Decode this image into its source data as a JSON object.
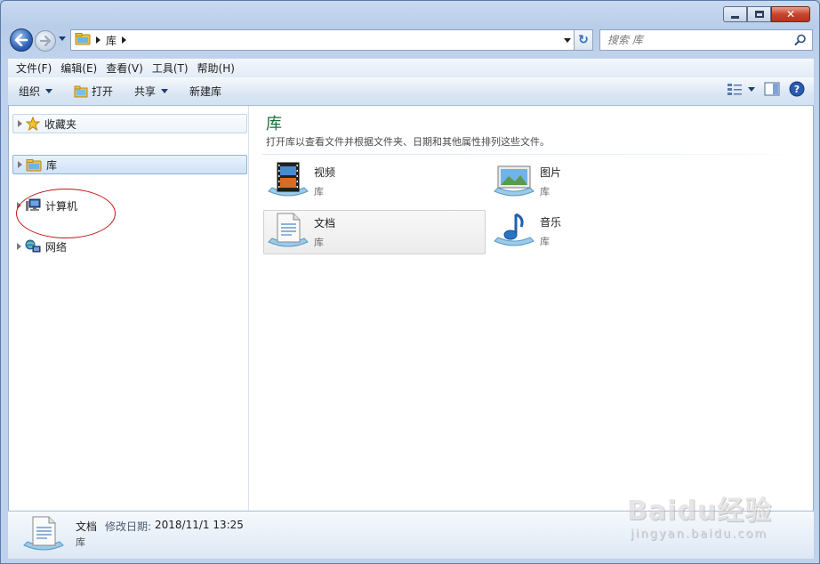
{
  "window": {
    "accent": "#1f6e3a"
  },
  "address": {
    "crumbs": [
      "库"
    ]
  },
  "search": {
    "placeholder": "搜索 库"
  },
  "menu": [
    "文件(F)",
    "编辑(E)",
    "查看(V)",
    "工具(T)",
    "帮助(H)"
  ],
  "commands": {
    "organize": "组织",
    "open": "打开",
    "share": "共享",
    "new_library": "新建库"
  },
  "nav": {
    "favorites": "收藏夹",
    "libraries": "库",
    "computer": "计算机",
    "network": "网络"
  },
  "main": {
    "title": "库",
    "subtitle": "打开库以查看文件并根据文件夹、日期和其他属性排列这些文件。",
    "items": [
      {
        "name": "视频",
        "type": "库",
        "icon": "video-library-icon"
      },
      {
        "name": "图片",
        "type": "库",
        "icon": "pictures-library-icon"
      },
      {
        "name": "文档",
        "type": "库",
        "icon": "documents-library-icon"
      },
      {
        "name": "音乐",
        "type": "库",
        "icon": "music-library-icon"
      }
    ]
  },
  "details": {
    "name": "文档",
    "modified_label": "修改日期:",
    "modified_value": "2018/11/1 13:25",
    "type": "库"
  },
  "watermark": {
    "brand": "Baidu经验",
    "url": "jingyan.baidu.com"
  }
}
